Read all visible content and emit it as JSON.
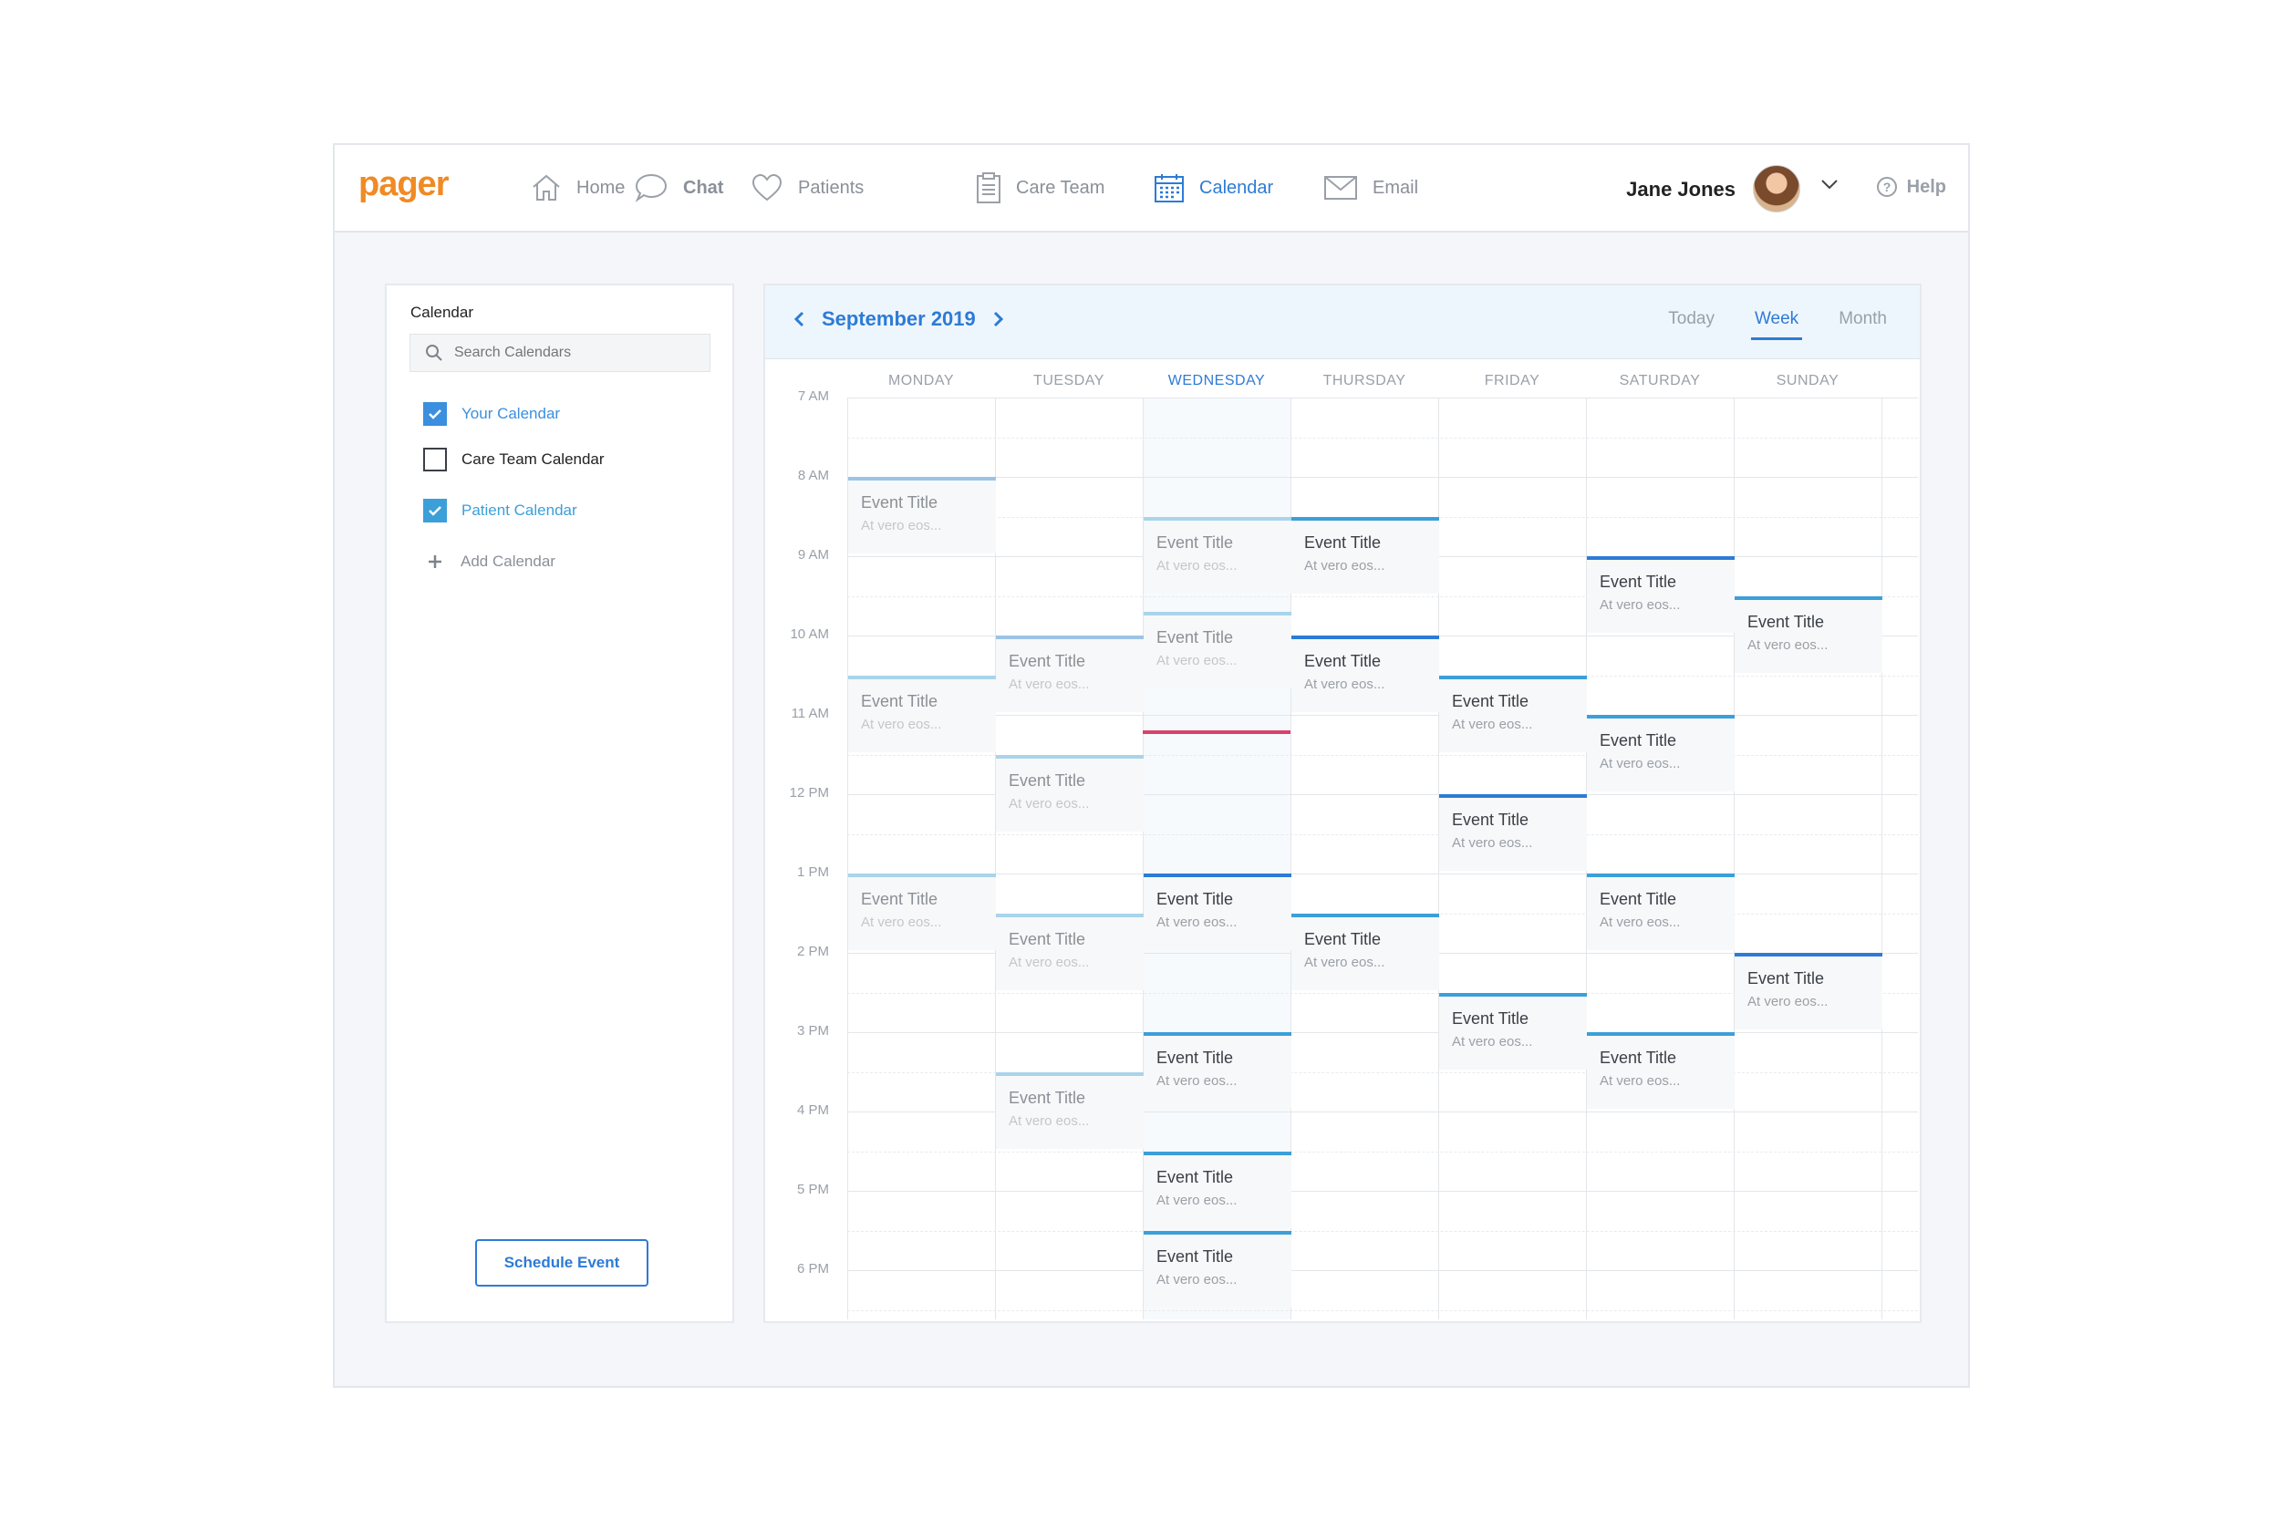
{
  "app": {
    "logo": "pager"
  },
  "nav": {
    "items": [
      {
        "label": "Home",
        "icon": "home-icon",
        "active": false
      },
      {
        "label": "Chat",
        "icon": "chat-icon",
        "active": false
      },
      {
        "label": "Patients",
        "icon": "heart-icon",
        "active": false
      },
      {
        "label": "Care Team",
        "icon": "clipboard-icon",
        "active": false
      },
      {
        "label": "Calendar",
        "icon": "calendar-icon",
        "active": true
      },
      {
        "label": "Email",
        "icon": "envelope-icon",
        "active": false
      }
    ],
    "user_name": "Jane Jones",
    "help_label": "Help"
  },
  "sidebar": {
    "title": "Calendar",
    "search_placeholder": "Search Calendars",
    "calendars": [
      {
        "label": "Your Calendar",
        "checked": true,
        "color": "#3b8fde"
      },
      {
        "label": "Care Team Calendar",
        "checked": false,
        "color": "#222222"
      },
      {
        "label": "Patient Calendar",
        "checked": true,
        "color": "#3b9fd9"
      }
    ],
    "add_label": "Add Calendar",
    "schedule_label": "Schedule Event"
  },
  "calendar": {
    "month_label": "September 2019",
    "views": [
      {
        "label": "Today",
        "active": false
      },
      {
        "label": "Week",
        "active": true
      },
      {
        "label": "Month",
        "active": false
      }
    ],
    "days": [
      {
        "label": "MONDAY",
        "today": false
      },
      {
        "label": "TUESDAY",
        "today": false
      },
      {
        "label": "WEDNESDAY",
        "today": true
      },
      {
        "label": "THURSDAY",
        "today": false
      },
      {
        "label": "FRIDAY",
        "today": false
      },
      {
        "label": "SATURDAY",
        "today": false
      },
      {
        "label": "SUNDAY",
        "today": false
      }
    ],
    "hours": [
      "7 AM",
      "8 AM",
      "9 AM",
      "10 AM",
      "11 AM",
      "12 PM",
      "1 PM",
      "2 PM",
      "3 PM",
      "4 PM",
      "5 PM",
      "6 PM"
    ],
    "current_time": {
      "day": 2,
      "hour": 11.2,
      "color": "#d8426b"
    },
    "colors": {
      "dark": "#2d7bd6",
      "medium": "#3b9fd9",
      "light": "#9cc3e6",
      "pale": "#a9d4ea"
    },
    "events": [
      {
        "day": 0,
        "start": 8.0,
        "title": "Event Title",
        "subtitle": "At vero eos...",
        "color": "light",
        "faded": true
      },
      {
        "day": 0,
        "start": 10.5,
        "title": "Event Title",
        "subtitle": "At vero eos...",
        "color": "pale",
        "faded": true
      },
      {
        "day": 0,
        "start": 13.0,
        "title": "Event Title",
        "subtitle": "At vero eos...",
        "color": "pale",
        "faded": true
      },
      {
        "day": 1,
        "start": 10.0,
        "title": "Event Title",
        "subtitle": "At vero eos...",
        "color": "light",
        "faded": true
      },
      {
        "day": 1,
        "start": 11.5,
        "title": "Event Title",
        "subtitle": "At vero eos...",
        "color": "pale",
        "faded": true
      },
      {
        "day": 1,
        "start": 13.5,
        "title": "Event Title",
        "subtitle": "At vero eos...",
        "color": "pale",
        "faded": true
      },
      {
        "day": 1,
        "start": 15.5,
        "title": "Event Title",
        "subtitle": "At vero eos...",
        "color": "pale",
        "faded": true
      },
      {
        "day": 2,
        "start": 8.5,
        "title": "Event Title",
        "subtitle": "At vero eos...",
        "color": "pale",
        "faded": true
      },
      {
        "day": 2,
        "start": 9.7,
        "title": "Event Title",
        "subtitle": "At vero eos...",
        "color": "pale",
        "faded": true
      },
      {
        "day": 2,
        "start": 13.0,
        "title": "Event Title",
        "subtitle": "At vero eos...",
        "color": "dark",
        "faded": false
      },
      {
        "day": 2,
        "start": 15.0,
        "title": "Event Title",
        "subtitle": "At vero eos...",
        "color": "medium",
        "faded": false
      },
      {
        "day": 2,
        "start": 16.5,
        "title": "Event Title",
        "subtitle": "At vero eos...",
        "color": "medium",
        "faded": false
      },
      {
        "day": 2,
        "start": 17.5,
        "title": "Event Title",
        "subtitle": "At vero eos...",
        "color": "medium",
        "faded": false
      },
      {
        "day": 3,
        "start": 8.5,
        "title": "Event Title",
        "subtitle": "At vero eos...",
        "color": "medium",
        "faded": false
      },
      {
        "day": 3,
        "start": 10.0,
        "title": "Event Title",
        "subtitle": "At vero eos...",
        "color": "dark",
        "faded": false
      },
      {
        "day": 3,
        "start": 13.5,
        "title": "Event Title",
        "subtitle": "At vero eos...",
        "color": "medium",
        "faded": false
      },
      {
        "day": 4,
        "start": 10.5,
        "title": "Event Title",
        "subtitle": "At vero eos...",
        "color": "medium",
        "faded": false
      },
      {
        "day": 4,
        "start": 12.0,
        "title": "Event Title",
        "subtitle": "At vero eos...",
        "color": "dark",
        "faded": false
      },
      {
        "day": 4,
        "start": 14.5,
        "title": "Event Title",
        "subtitle": "At vero eos...",
        "color": "medium",
        "faded": false
      },
      {
        "day": 5,
        "start": 9.0,
        "title": "Event Title",
        "subtitle": "At vero eos...",
        "color": "dark",
        "faded": false
      },
      {
        "day": 5,
        "start": 11.0,
        "title": "Event Title",
        "subtitle": "At vero eos...",
        "color": "medium",
        "faded": false
      },
      {
        "day": 5,
        "start": 13.0,
        "title": "Event Title",
        "subtitle": "At vero eos...",
        "color": "medium",
        "faded": false
      },
      {
        "day": 5,
        "start": 15.0,
        "title": "Event Title",
        "subtitle": "At vero eos...",
        "color": "medium",
        "faded": false
      },
      {
        "day": 6,
        "start": 9.5,
        "title": "Event Title",
        "subtitle": "At vero eos...",
        "color": "medium",
        "faded": false
      },
      {
        "day": 6,
        "start": 14.0,
        "title": "Event Title",
        "subtitle": "At vero eos...",
        "color": "dark",
        "faded": false
      }
    ]
  }
}
